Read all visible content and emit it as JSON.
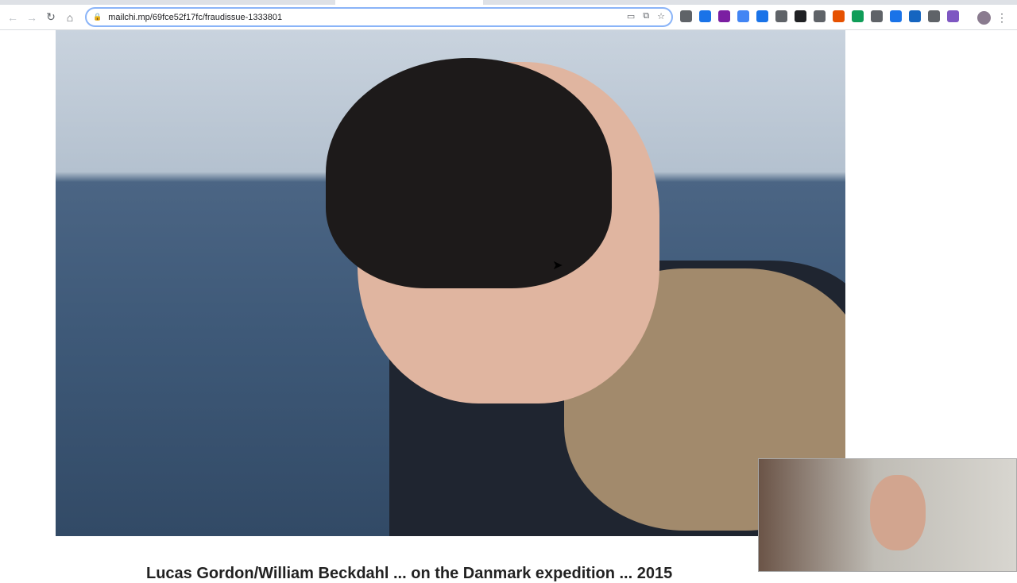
{
  "browser": {
    "url": "mailchi.mp/69fce52f17fc/fraudissue-1333801",
    "back_icon": "arrow-left-icon",
    "forward_icon": "arrow-right-icon",
    "reload_icon": "reload-icon",
    "home_icon": "home-icon",
    "extension_colors": [
      "#5f6368",
      "#1a73e8",
      "#7b1fa2",
      "#4285f4",
      "#1a73e8",
      "#5f6368",
      "#202124",
      "#5f6368",
      "#e65100",
      "#0f9d58",
      "#5f6368",
      "#1a73e8",
      "#1565c0",
      "#5f6368",
      "#7e57c2"
    ]
  },
  "article": {
    "partial_text": "Lucas Gordon/William Beckdahl ... on the Danmark expedition ... 2015"
  }
}
